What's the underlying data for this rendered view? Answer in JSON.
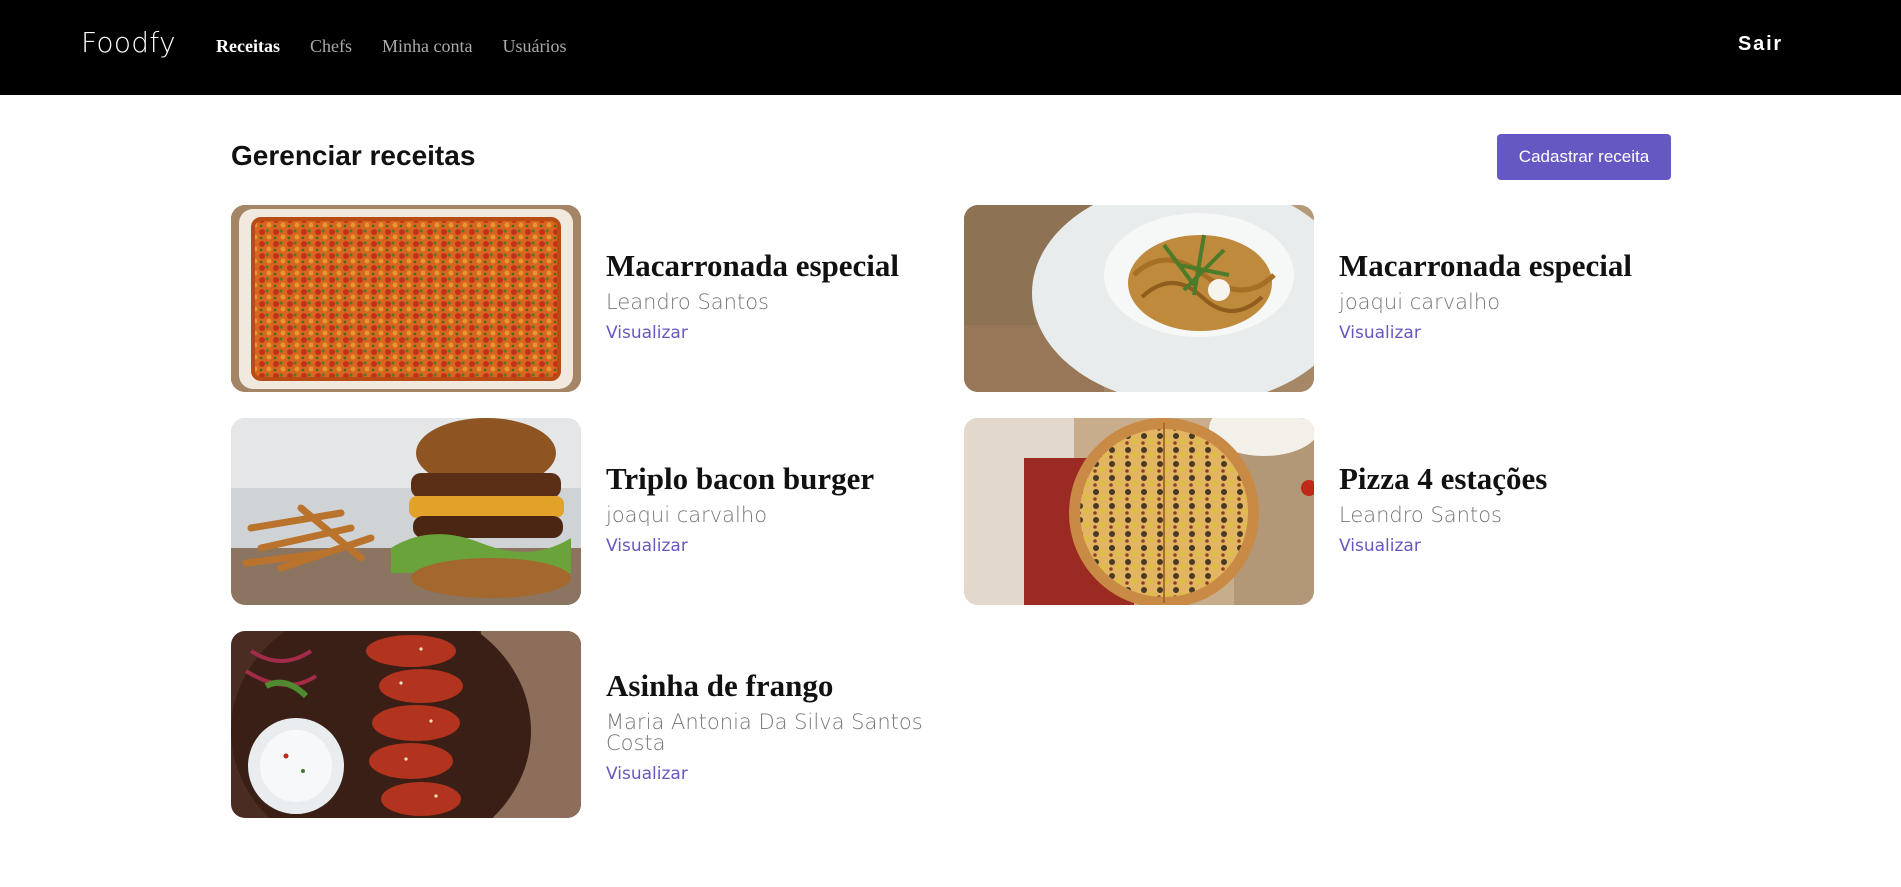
{
  "header": {
    "logo": "Foodfy",
    "nav": [
      {
        "label": "Receitas",
        "active": true
      },
      {
        "label": "Chefs",
        "active": false
      },
      {
        "label": "Minha conta",
        "active": false
      },
      {
        "label": "Usuários",
        "active": false
      }
    ],
    "logout_label": "Sair"
  },
  "main": {
    "title": "Gerenciar receitas",
    "add_button_label": "Cadastrar receita",
    "recipes": [
      {
        "title": "Macarronada especial",
        "author": "Leandro Santos",
        "link_label": "Visualizar",
        "image": "baked-pasta-photo"
      },
      {
        "title": "Macarronada especial",
        "author": "joaqui carvalho",
        "link_label": "Visualizar",
        "image": "spaghetti-plate-photo"
      },
      {
        "title": "Triplo bacon burger",
        "author": "joaqui carvalho",
        "link_label": "Visualizar",
        "image": "burger-fries-photo"
      },
      {
        "title": "Pizza 4 estações",
        "author": "Leandro Santos",
        "link_label": "Visualizar",
        "image": "pizza-photo"
      },
      {
        "title": "Asinha de frango",
        "author": "Maria Antonia Da Silva Santos Costa",
        "link_label": "Visualizar",
        "image": "chicken-wings-photo"
      }
    ]
  },
  "colors": {
    "header_bg": "#000000",
    "accent": "#6558c3",
    "muted_text": "#777777"
  }
}
